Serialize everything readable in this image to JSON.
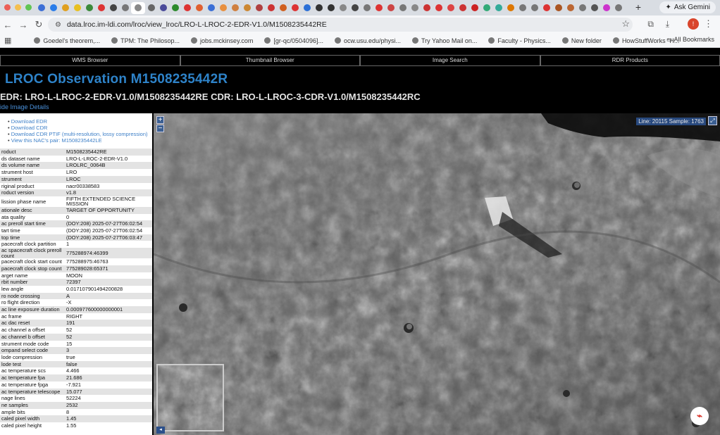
{
  "browser": {
    "tab_colors": [
      "#3d6fd6",
      "#2b7de9",
      "#e0a020",
      "#e8c020",
      "#3b8a3b",
      "#d33",
      "#444",
      "#777",
      "#888",
      "#666",
      "#4a4a9a",
      "#2c8a2c",
      "#d33",
      "#e06030",
      "#3b6fd6",
      "#e89040",
      "#d08040",
      "#c83",
      "#b04040",
      "#c33",
      "#d06020",
      "#d33",
      "#2b6fd6",
      "#333",
      "#333",
      "#888",
      "#444",
      "#777",
      "#d33",
      "#c44",
      "#777",
      "#888",
      "#c33",
      "#d33",
      "#d44",
      "#c33",
      "#c22",
      "#3a7",
      "#3a9",
      "#d70",
      "#777",
      "#777",
      "#d33",
      "#a52",
      "#b63",
      "#777",
      "#555",
      "#c3c",
      "#777"
    ],
    "new_tab_label": "+",
    "ask_gemini": "Ask Gemini",
    "url": "data.lroc.im-ldi.com/lroc/view_lroc/LRO-L-LROC-2-EDR-V1.0/M1508235442RE",
    "profile_initial": "!",
    "bookmarks": [
      "Goedel's theorem,...",
      "TPM: The Philosop...",
      "jobs.mckinsey.com",
      "[gr-qc/0504096]...",
      "ocw.usu.edu/physi...",
      "Try Yahoo Mail on...",
      "Faculty - Physics...",
      "New folder",
      "HowStuffWorks \"H..."
    ],
    "all_bookmarks": "All Bookmarks"
  },
  "site": {
    "nav": [
      "WMS Browser",
      "Thumbnail Browser",
      "Image Search",
      "RDR Products"
    ],
    "title": "LROC Observation M1508235442R",
    "edr_line": "EDR: LRO-L-LROC-2-EDR-V1.0/M1508235442RE CDR: LRO-L-LROC-3-CDR-V1.0/M1508235442RC",
    "hide_link": "ide Image Details",
    "links": [
      "Download EDR",
      "Download CDR",
      "Download CDR PTIF (multi-resolution, lossy compression)",
      "View this NAC's pair: M1508235442LE"
    ],
    "meta": [
      [
        "roduct",
        "M1508235442RE"
      ],
      [
        "ds dataset name",
        "LRO-L-LROC-2-EDR-V1.0"
      ],
      [
        "ds volume name",
        "LROLRC_0064B"
      ],
      [
        "strument host",
        "LRO"
      ],
      [
        "strument",
        "LROC"
      ],
      [
        "riginal product",
        "nacr00338583"
      ],
      [
        "roduct version",
        "v1.8"
      ],
      [
        "lission phase name",
        "FIFTH EXTENDED SCIENCE MISSION"
      ],
      [
        "ationale desc",
        "TARGET OF OPPORTUNITY"
      ],
      [
        "ata quality",
        "0"
      ],
      [
        "ac preroll start time",
        "(DOY:208) 2025-07-27T06:02:54"
      ],
      [
        "tart time",
        "(DOY:208) 2025-07-27T06:02:54"
      ],
      [
        "top time",
        "(DOY:208) 2025-07-27T06:03:47"
      ],
      [
        "pacecraft clock partition",
        "1"
      ],
      [
        "ac spacecraft clock preroll count",
        "775288974:46399"
      ],
      [
        "pacecraft clock start count",
        "775288975:46763"
      ],
      [
        "pacecraft clock stop count",
        "775289028:65371"
      ],
      [
        "arget name",
        "MOON"
      ],
      [
        "rbit number",
        "72397"
      ],
      [
        "lew angle",
        "0.0171079014942008​28"
      ],
      [
        "ro node crossing",
        "A"
      ],
      [
        "ro flight direction",
        "-X"
      ],
      [
        "ac line exposure duration",
        "0.000977600000000001"
      ],
      [
        "ac frame",
        "RIGHT"
      ],
      [
        "ac dac reset",
        "191"
      ],
      [
        "ac channel a offset",
        "52"
      ],
      [
        "ac channel b offset",
        "52"
      ],
      [
        "strument mode code",
        "15"
      ],
      [
        "ompand select code",
        "3"
      ],
      [
        "lode compression",
        "true"
      ],
      [
        "lode test",
        "false"
      ],
      [
        "ac temperature scs",
        "4.466"
      ],
      [
        "ac temperature fpa",
        "21.686"
      ],
      [
        "ac temperature fpga",
        "-7.921"
      ],
      [
        "ac temperature telescope",
        "15.077"
      ],
      [
        "nage lines",
        "52224"
      ],
      [
        "ne samples",
        "2532"
      ],
      [
        "ample bits",
        "8"
      ],
      [
        "caled pixel width",
        "1.45"
      ],
      [
        "caled pixel height",
        "1.55"
      ]
    ]
  },
  "viewer": {
    "coord": "Line: 20115 Sample: 1763",
    "zoom_in": "+",
    "zoom_out": "−",
    "fullscreen": "⤢",
    "overview_btn": "◂",
    "pdf_icon": "⌁"
  }
}
